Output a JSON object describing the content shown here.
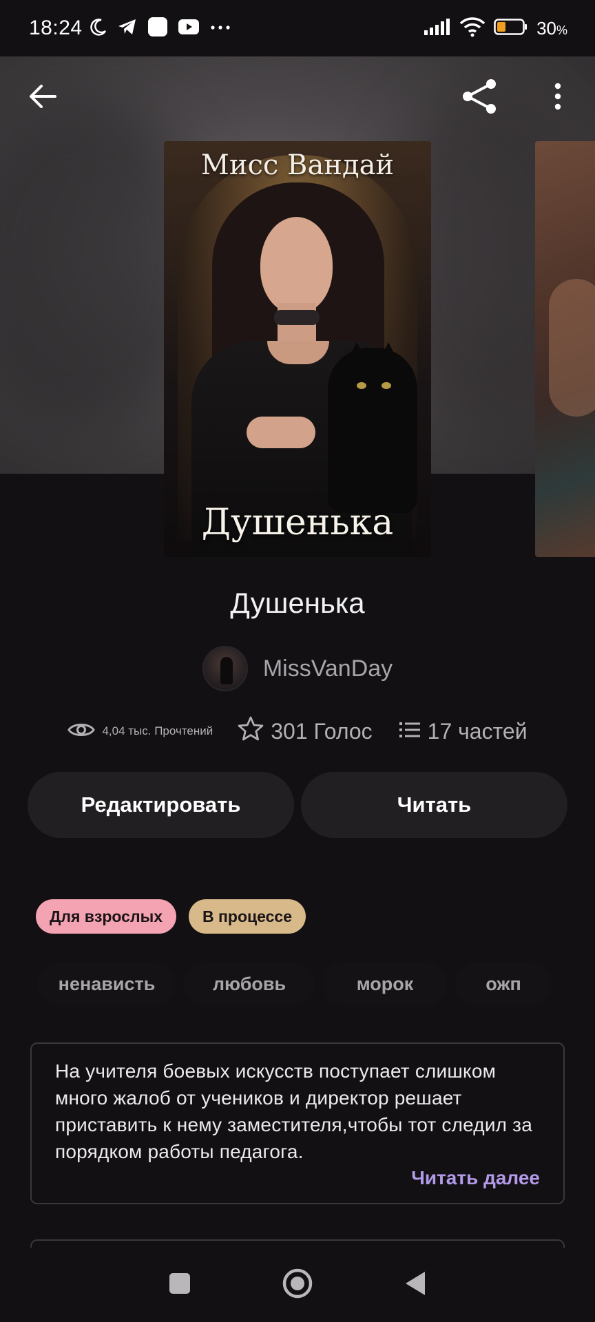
{
  "status_bar": {
    "time": "18:24",
    "battery_percent": "30",
    "battery_suffix": "%",
    "icons": [
      "moon-icon",
      "telegram-icon",
      "app-icon",
      "youtube-icon",
      "more-dots-icon",
      "signal-icon",
      "wifi-icon",
      "battery-icon"
    ]
  },
  "toolbar": {
    "back_icon": "arrow-left-icon",
    "share_icon": "share-icon",
    "menu_icon": "more-vertical-icon"
  },
  "cover": {
    "author_text": "Мисс Вандай",
    "title_text": "Душенька"
  },
  "book": {
    "title": "Душенька",
    "author": "MissVanDay"
  },
  "stats": {
    "reads": "4,04 тыс. Прочтений",
    "votes": "301 Голос",
    "parts": "17 частей"
  },
  "actions": {
    "edit_label": "Редактировать",
    "read_label": "Читать"
  },
  "badges": {
    "adult": "Для взрослых",
    "status": "В процессе"
  },
  "tags": [
    "ненависть",
    "любовь",
    "морок",
    "ожп"
  ],
  "description": {
    "text": "На учителя боевых искусств поступает слишком много жалоб от учеников и директор решает приставить к нему заместителя,чтобы тот следил за порядком работы педагога.",
    "read_more": "Читать далее"
  },
  "colors": {
    "background": "#121013",
    "button_bg": "#221f22",
    "adult_badge": "#f4a3b2",
    "status_badge": "#d8b98a",
    "accent_link": "#b29ae8"
  }
}
